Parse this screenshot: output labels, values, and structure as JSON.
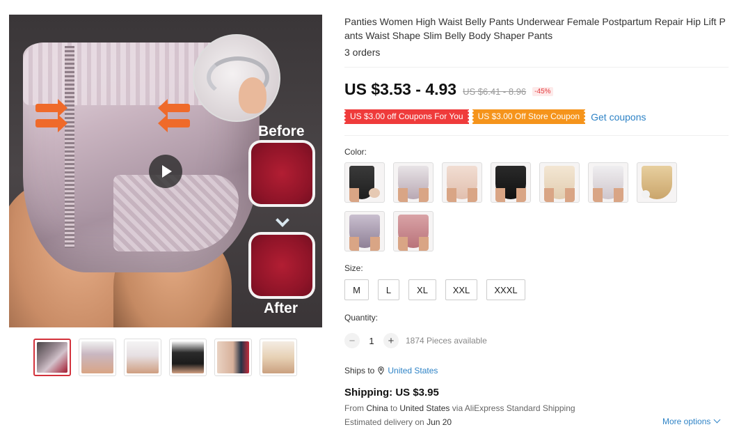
{
  "product": {
    "title": "Panties Women High Waist Belly Pants Underwear Female Postpartum Repair Hip Lift Pants Waist Shape Slim Belly Body Shaper Pants",
    "orders": "3 orders"
  },
  "gallery": {
    "before_label": "Before",
    "after_label": "After",
    "play_icon": "play-icon",
    "thumbnail_count": 6
  },
  "price": {
    "current": "US $3.53 - 4.93",
    "original": "US $6.41 - 8.96",
    "discount": "-45%"
  },
  "coupons": {
    "coupon1": "US $3.00 off Coupons For You",
    "coupon2": "US $3.00 Off Store Coupon",
    "get_coupons": "Get coupons"
  },
  "color": {
    "label": "Color:",
    "option_count": 9
  },
  "size": {
    "label": "Size:",
    "options": [
      "M",
      "L",
      "XL",
      "XXL",
      "XXXL"
    ]
  },
  "quantity": {
    "label": "Quantity:",
    "minus": "−",
    "value": "1",
    "plus": "+",
    "available": "1874 Pieces available"
  },
  "shipping": {
    "ships_to_label": "Ships to",
    "country": "United States",
    "pin_icon": "location-pin-icon",
    "title": "Shipping: US $3.95",
    "route_from": "From ",
    "route_origin": "China",
    "route_to": " to ",
    "route_dest": "United States",
    "route_via": " via AliExpress Standard Shipping",
    "estimated_label": "Estimated delivery on ",
    "estimated_date": "Jun 20",
    "more_options": "More options"
  },
  "colors": {
    "accent_red": "#e4393c",
    "coupon_red": "#ef3b3b",
    "coupon_orange": "#f5941b",
    "link_blue": "#2e83c6"
  }
}
